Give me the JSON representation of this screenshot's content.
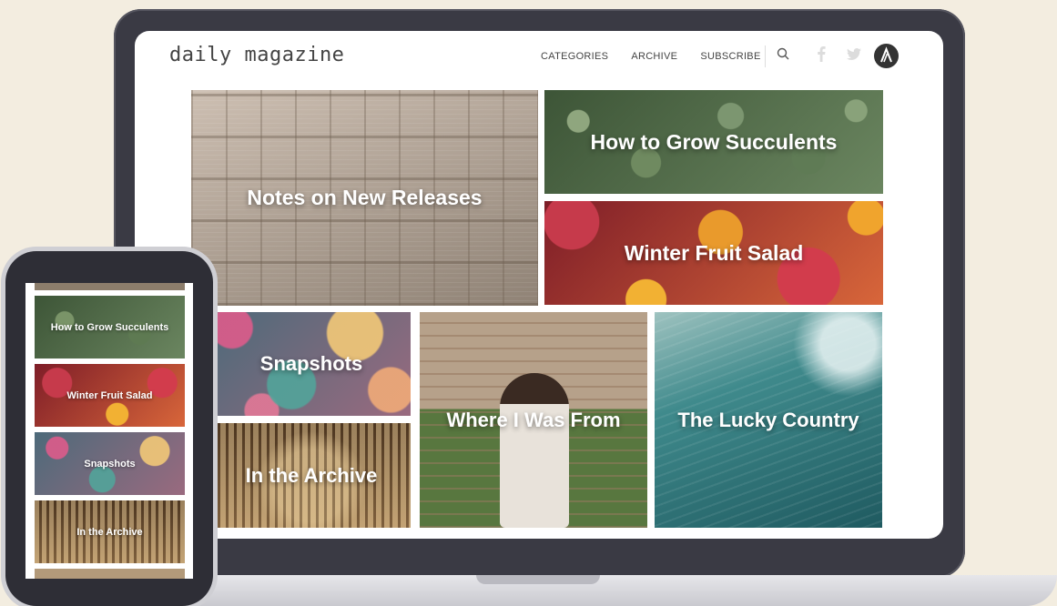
{
  "site": {
    "logo": "daily magazine",
    "nav": [
      "CATEGORIES",
      "ARCHIVE",
      "SUBSCRIBE"
    ],
    "icons": [
      "search-icon",
      "facebook-icon",
      "twitter-icon",
      "avatar-logo-icon"
    ]
  },
  "articles": {
    "notes": "Notes on New Releases",
    "succulents": "How to Grow Succulents",
    "fruit": "Winter Fruit Salad",
    "snapshots": "Snapshots",
    "archive": "In the Archive",
    "where": "Where I Was From",
    "lucky": "The Lucky Country"
  },
  "mobile": {
    "tiles": [
      "How to Grow Succulents",
      "Winter Fruit Salad",
      "Snapshots",
      "In the Archive"
    ]
  },
  "colors": {
    "background": "#f3ede0",
    "device_frame": "#3a3a44",
    "text": "#444444"
  }
}
